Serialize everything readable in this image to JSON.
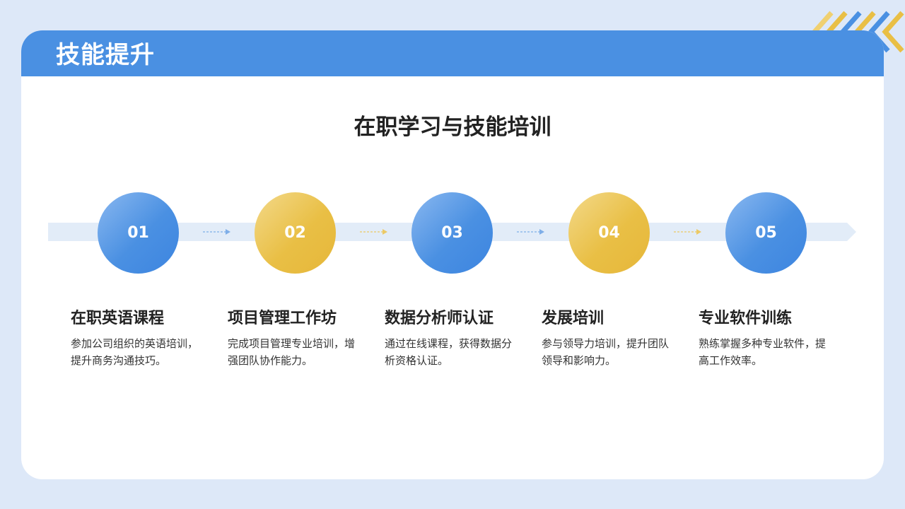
{
  "header": {
    "title": "技能提升"
  },
  "main": {
    "subtitle": "在职学习与技能培训"
  },
  "colors": {
    "blue": "#4a90e2",
    "yellow": "#e9bf45",
    "background": "#dde8f8"
  },
  "steps": [
    {
      "number": "01",
      "title": "在职英语课程",
      "desc": "参加公司组织的英语培训，提升商务沟通技巧。",
      "color": "blue"
    },
    {
      "number": "02",
      "title": "项目管理工作坊",
      "desc": "完成项目管理专业培训，增强团队协作能力。",
      "color": "yellow"
    },
    {
      "number": "03",
      "title": "数据分析师认证",
      "desc": "通过在线课程，获得数据分析资格认证。",
      "color": "blue"
    },
    {
      "number": "04",
      "title": "发展培训",
      "desc": "参与领导力培训，提升团队领导和影响力。",
      "color": "yellow"
    },
    {
      "number": "05",
      "title": "专业软件训练",
      "desc": "熟练掌握多种专业软件，提高工作效率。",
      "color": "blue"
    }
  ]
}
